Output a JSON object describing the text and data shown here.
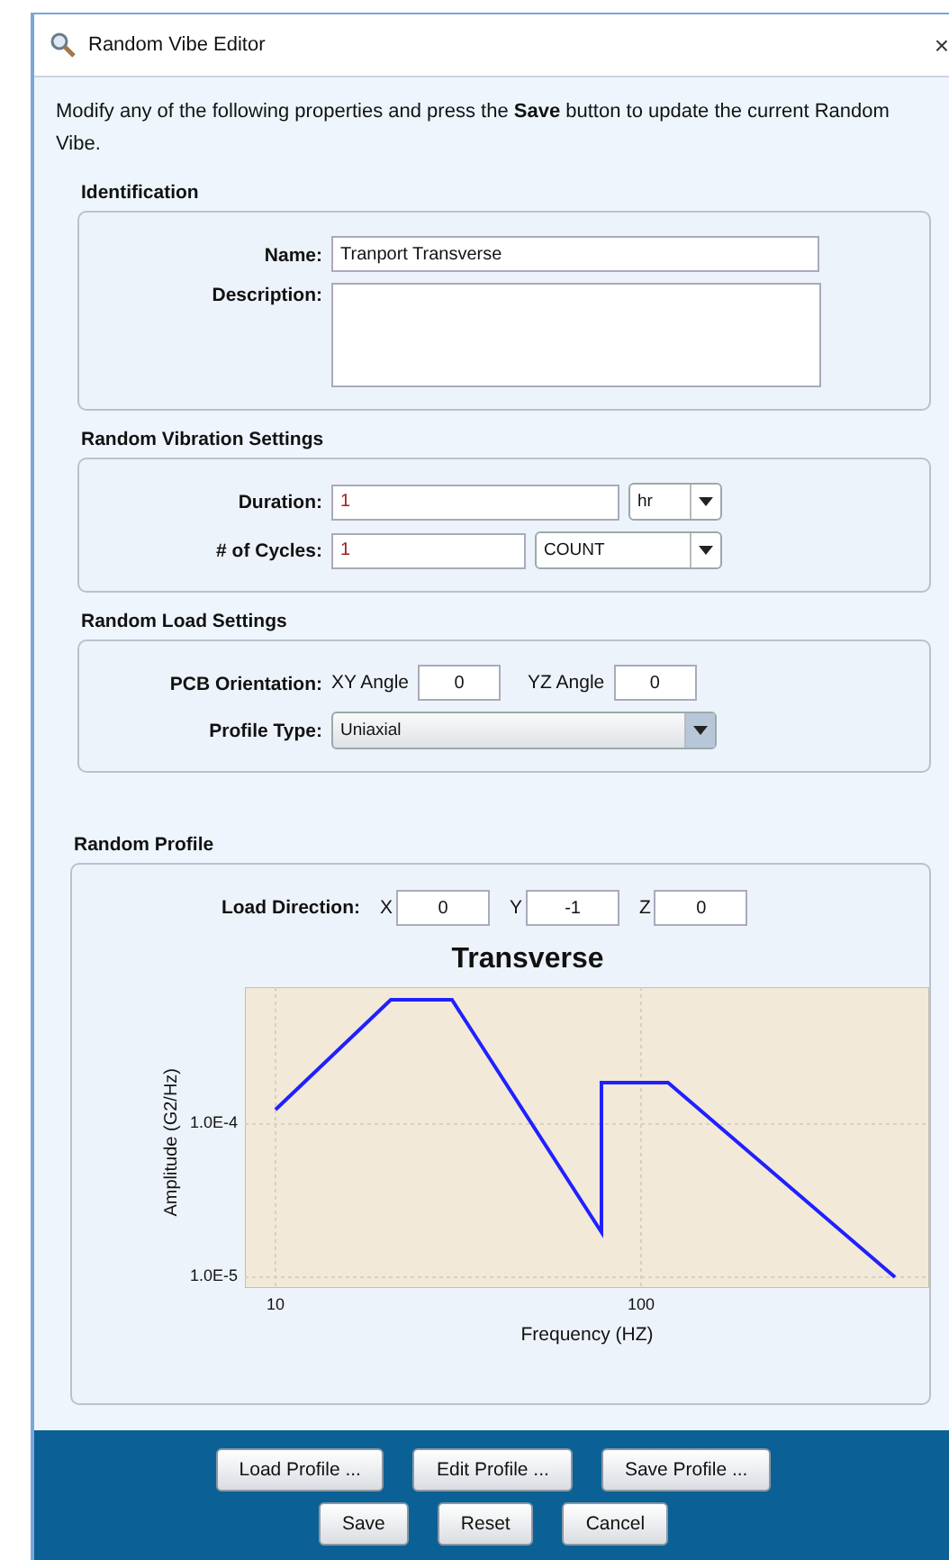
{
  "window": {
    "title": "Random Vibe Editor",
    "close": "×"
  },
  "intro": "Modify any of the following properties and press the **Save** button to update the current Random Vibe.",
  "identification": {
    "title": "Identification",
    "name_label": "Name:",
    "name_value": "Tranport Transverse",
    "description_label": "Description:"
  },
  "vibration": {
    "title": "Random Vibration Settings",
    "duration_label": "Duration:",
    "duration_value": "1",
    "duration_unit": "hr",
    "cycles_label": "# of Cycles:",
    "cycles_value": "1",
    "cycles_unit": "COUNT"
  },
  "load": {
    "title": "Random Load Settings",
    "orientation_label": "PCB Orientation:",
    "xy_label": "XY Angle",
    "xy_value": "0",
    "yz_label": "YZ Angle",
    "yz_value": "0",
    "profile_label": "Profile Type:",
    "profile_value": "Uniaxial"
  },
  "profile": {
    "title": "Random Profile",
    "direction_label": "Load Direction:",
    "axes": [
      {
        "label": "X",
        "value": "0"
      },
      {
        "label": "Y",
        "value": "-1"
      },
      {
        "label": "Z",
        "value": "0"
      }
    ],
    "chart": {
      "title": "Transverse",
      "xlabel": "Frequency (HZ)",
      "ylabel": "Amplitude (G2/Hz)",
      "xticks": [
        "10",
        "100"
      ],
      "yticks": [
        "1.0E-4",
        "1.0E-5"
      ]
    }
  },
  "buttons_top": [
    "Load Profile ...",
    "Edit Profile ...",
    "Save Profile ..."
  ],
  "buttons_bottom": [
    "Save",
    "Reset",
    "Cancel"
  ]
}
